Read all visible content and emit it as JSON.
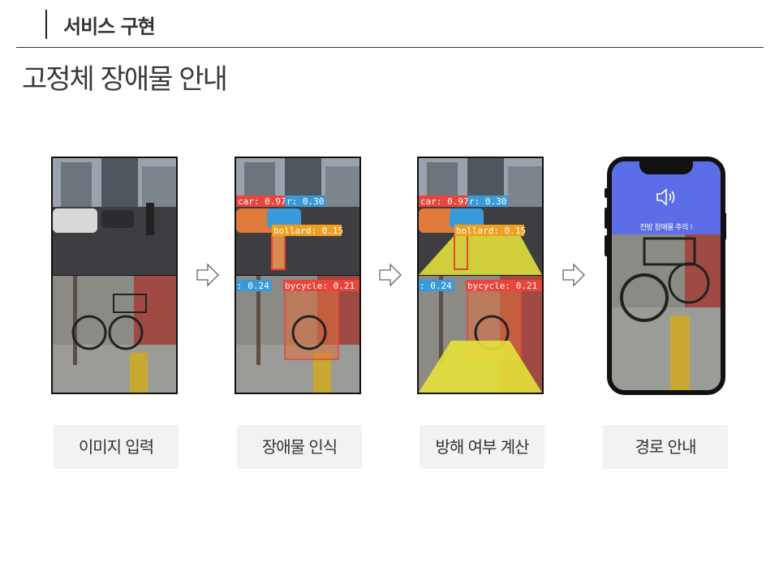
{
  "header": {
    "section_title": "서비스 구현",
    "page_title": "고정체 장애물 안내"
  },
  "steps": [
    {
      "label": "이미지 입력"
    },
    {
      "label": "장애물 인식"
    },
    {
      "label": "방해 여부 계산"
    },
    {
      "label": "경로 안내"
    }
  ],
  "detections": {
    "car": "car: 0.97",
    "car2": "r: 0.30",
    "bollard": "bollard: 0.15",
    "bollard2": ": 0.24",
    "bicycle": "bycycle: 0.21"
  },
  "phone": {
    "alert_text": "전방 장애물 주의 !",
    "icon": "speaker-icon"
  },
  "colors": {
    "banner": "#5b6ee8",
    "detect_red": "#e8453c",
    "detect_blue": "#3a9ad9",
    "detect_orange": "#f0a020",
    "zone_yellow": "#e6e23a"
  }
}
